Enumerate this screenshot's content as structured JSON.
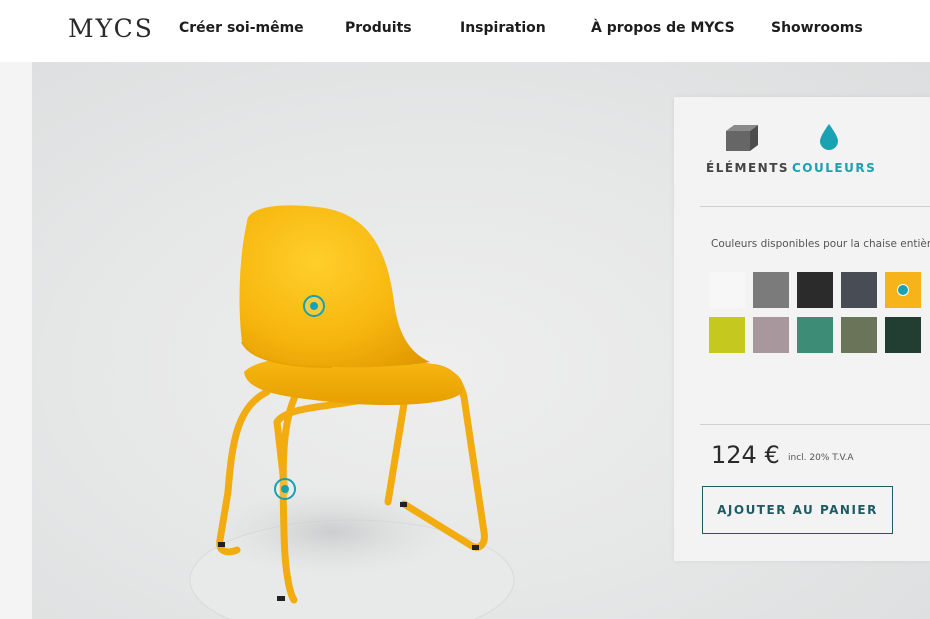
{
  "brand": {
    "logo": "MYCS"
  },
  "nav": {
    "items": [
      {
        "label": "Créer soi-même"
      },
      {
        "label": "Produits"
      },
      {
        "label": "Inspiration"
      },
      {
        "label": "À propos de MYCS"
      },
      {
        "label": "Showrooms"
      }
    ]
  },
  "viewer": {
    "product_color": "#f6b30e",
    "hotspot_color": "#19a0b1"
  },
  "panel": {
    "tabs": [
      {
        "label": "ÉLÉMENTS",
        "icon": "cube-icon",
        "active": false
      },
      {
        "label": "COULEURS",
        "icon": "droplet-icon",
        "active": true
      }
    ],
    "colors_caption": "Couleurs disponibles pour la chaise entière",
    "swatches": [
      {
        "color": "#f7f7f7",
        "selected": false
      },
      {
        "color": "#7b7b7b",
        "selected": false
      },
      {
        "color": "#2b2b2b",
        "selected": false
      },
      {
        "color": "#484c54",
        "selected": false
      },
      {
        "color": "#f6b41a",
        "selected": true
      },
      {
        "color": "#c5c81e",
        "selected": false
      },
      {
        "color": "#a8979c",
        "selected": false
      },
      {
        "color": "#3d8c76",
        "selected": false
      },
      {
        "color": "#6a7459",
        "selected": false
      },
      {
        "color": "#223d31",
        "selected": false
      }
    ],
    "price": "124 €",
    "vat_note": "incl. 20% T.V.A",
    "cart_button": "AJOUTER AU PANIER",
    "accent_color": "#1aa1b2"
  }
}
